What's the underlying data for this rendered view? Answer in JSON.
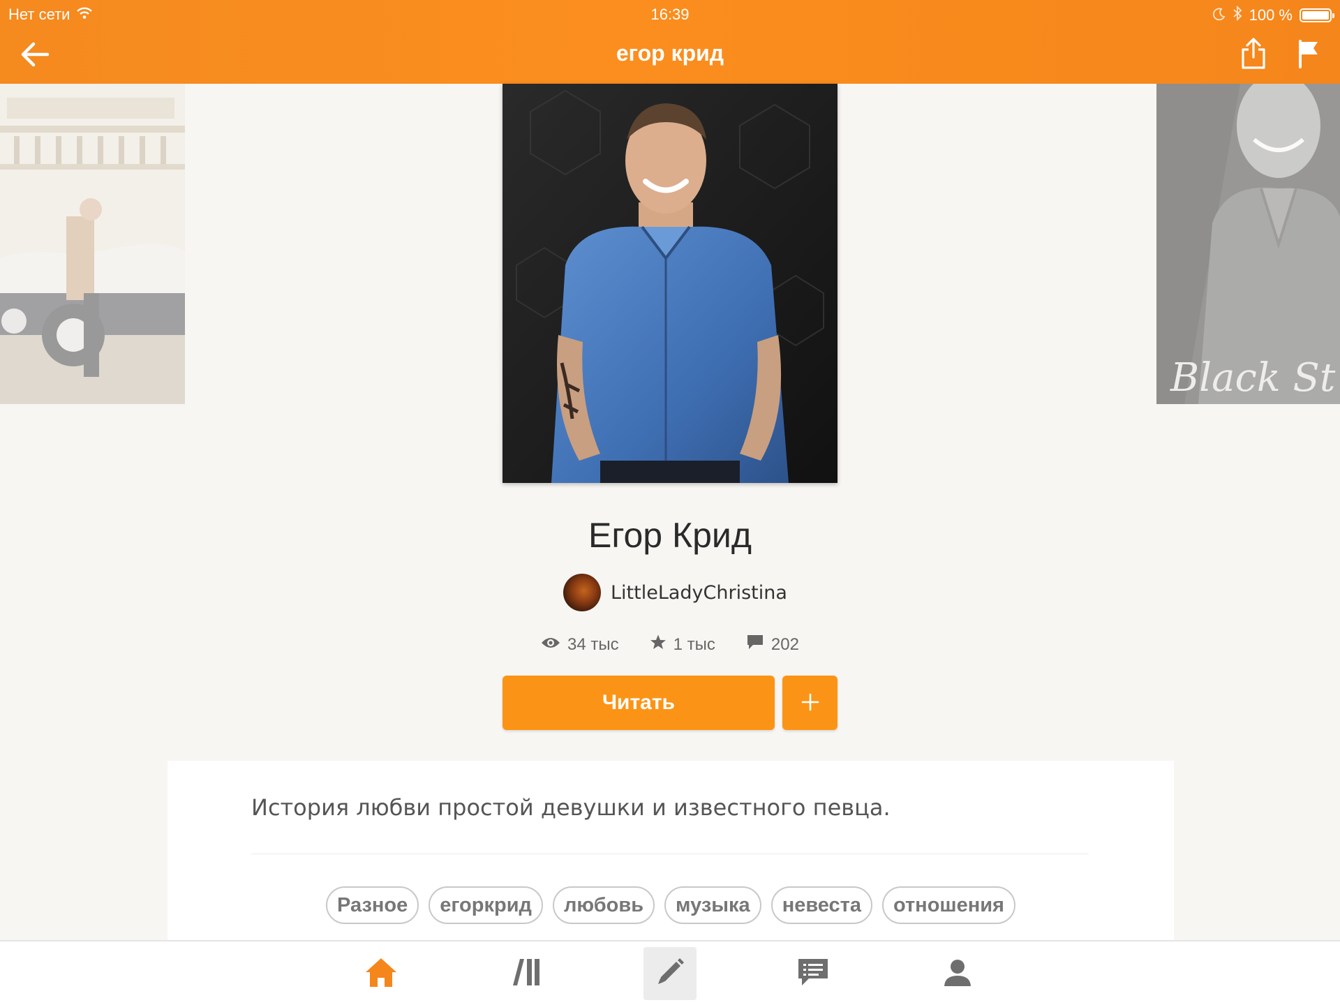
{
  "status_bar": {
    "carrier": "Нет сети",
    "time": "16:39",
    "battery": "100 %"
  },
  "nav": {
    "title": "егор крид",
    "back_icon": "arrow-left-icon",
    "share_icon": "share-icon",
    "report_icon": "flag-icon"
  },
  "story": {
    "title": "Егор Крид",
    "author": "LittleLadyChristina",
    "stats": {
      "reads": "34 тыс",
      "votes": "1 тыс",
      "comments": "202"
    },
    "read_button": "Читать",
    "add_button_icon": "plus-icon",
    "description": "История любви простой девушки и известного певца.",
    "tags": [
      "Разное",
      "егоркрид",
      "любовь",
      "музыка",
      "невеста",
      "отношения"
    ]
  },
  "covers": {
    "right_cover_text": "Black St"
  },
  "tabbar": {
    "items": [
      {
        "icon": "home-icon",
        "active": true
      },
      {
        "icon": "library-icon",
        "active": false
      },
      {
        "icon": "pencil-icon",
        "active": false
      },
      {
        "icon": "messages-icon",
        "active": false
      },
      {
        "icon": "profile-icon",
        "active": false
      }
    ]
  },
  "colors": {
    "brand_orange": "#f58a1f",
    "button_orange": "#fb9416",
    "tab_active": "#f5861b",
    "tab_inactive": "#6e6e6e"
  }
}
